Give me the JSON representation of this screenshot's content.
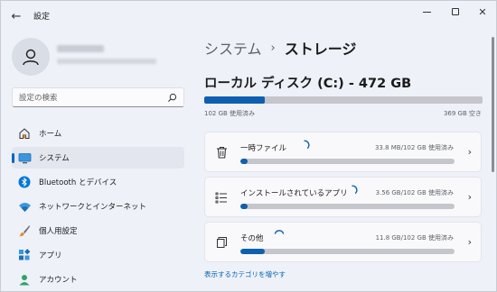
{
  "app": {
    "title": "設定"
  },
  "search": {
    "placeholder": "設定の検索"
  },
  "sidebar": {
    "items": [
      {
        "label": "ホーム",
        "icon": "home-icon"
      },
      {
        "label": "システム",
        "icon": "monitor-icon",
        "active": true
      },
      {
        "label": "Bluetooth とデバイス",
        "icon": "bluetooth-icon"
      },
      {
        "label": "ネットワークとインターネット",
        "icon": "wifi-icon"
      },
      {
        "label": "個人用設定",
        "icon": "paintbrush-icon"
      },
      {
        "label": "アプリ",
        "icon": "apps-icon"
      },
      {
        "label": "アカウント",
        "icon": "account-icon"
      }
    ]
  },
  "breadcrumb": {
    "parent": "システム",
    "separator": "›",
    "current": "ストレージ"
  },
  "disk": {
    "title": "ローカル ディスク (C:) - 472 GB",
    "used_label": "102 GB 使用済み",
    "free_label": "369 GB 空き",
    "used_fraction": 0.216
  },
  "categories": [
    {
      "label": "一時ファイル",
      "usage": "33.8 MB/102 GB 使用済み",
      "fraction": 0.003,
      "icon": "trash-icon"
    },
    {
      "label": "インストールされているアプリ",
      "usage": "3.56 GB/102 GB 使用済み",
      "fraction": 0.035,
      "icon": "installed-apps-icon"
    },
    {
      "label": "その他",
      "usage": "11.8 GB/102 GB 使用済み",
      "fraction": 0.116,
      "icon": "other-files-icon"
    }
  ],
  "more_link": "表示するカテゴリを増やす",
  "colors": {
    "accent": "#0f5fb0",
    "link": "#0063b1",
    "bar_track": "#c4c6cb"
  }
}
